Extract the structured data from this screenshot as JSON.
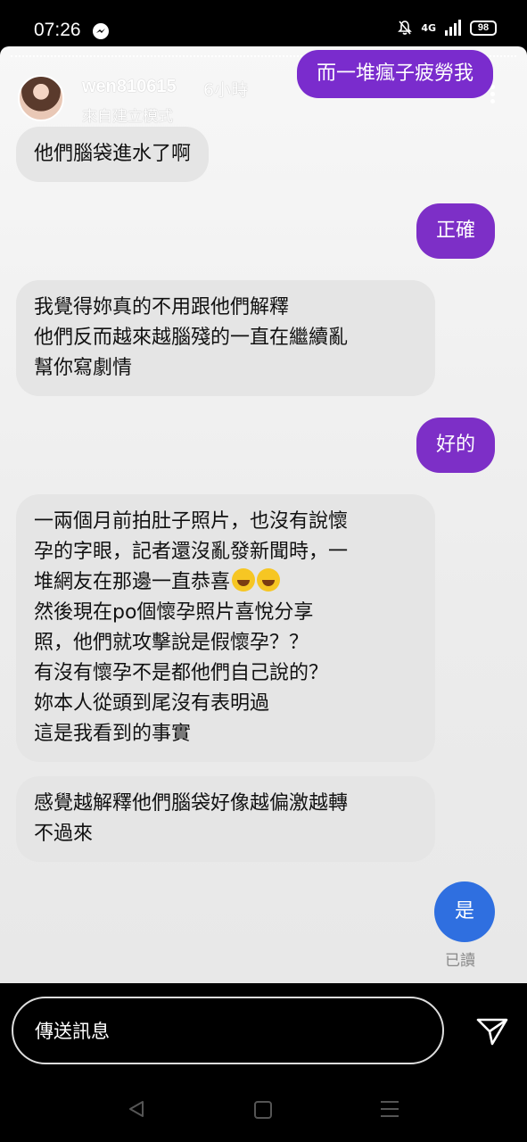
{
  "status_bar": {
    "time": "07:26",
    "network": "4G",
    "battery": "98"
  },
  "story": {
    "username": "wen810615",
    "time_ago": "6小時",
    "subtitle": "來自建立模式"
  },
  "messages": [
    {
      "side": "out",
      "text": "而一堆瘋子疲勞我"
    },
    {
      "side": "in",
      "text": "他們腦袋進水了啊"
    },
    {
      "side": "out",
      "text": "正確"
    },
    {
      "side": "in",
      "lines": [
        "我覺得妳真的不用跟他們解釋",
        "他們反而越來越腦殘的一直在繼續亂",
        "幫你寫劇情"
      ]
    },
    {
      "side": "out",
      "text": "好的"
    },
    {
      "side": "in",
      "lines": [
        "一兩個月前拍肚子照片，也沒有說懷",
        "孕的字眼，記者還沒亂發新聞時，一",
        "堆網友在那邊一直恭喜",
        "然後現在po個懷孕照片喜悅分享",
        "照，他們就攻擊說是假懷孕？？",
        "有沒有懷孕不是都他們自己說的？",
        "妳本人從頭到尾沒有表明過",
        "這是我看到的事實"
      ]
    },
    {
      "side": "in",
      "lines": [
        "感覺越解釋他們腦袋好像越偏激越轉",
        "不過來"
      ]
    },
    {
      "side": "out",
      "text": "是"
    }
  ],
  "read_receipt": "已讀",
  "composer": {
    "placeholder": "傳送訊息"
  },
  "colors": {
    "outgoing": "#7d2fc7",
    "outgoing_last": "#2f6fe0",
    "incoming": "#e5e5e5"
  },
  "icons": [
    "messenger-icon",
    "mute-bell-icon",
    "signal-icon",
    "battery-icon",
    "more-icon",
    "send-icon",
    "back-icon",
    "home-icon",
    "menu-icon"
  ]
}
